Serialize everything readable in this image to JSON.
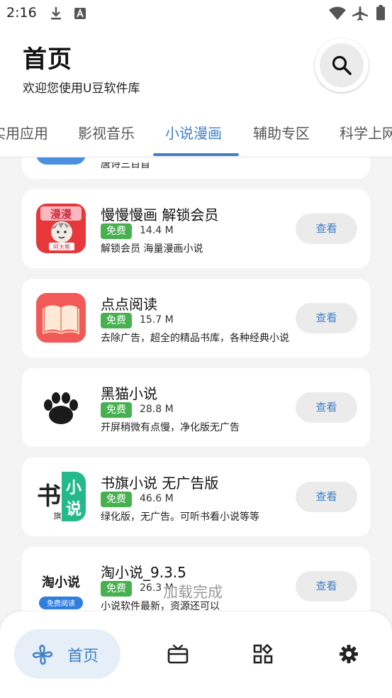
{
  "status_bar": {
    "time": "2:16"
  },
  "header": {
    "title": "首页",
    "subtitle": "欢迎您使用U豆软件库"
  },
  "tabs": [
    {
      "label": "实用应用"
    },
    {
      "label": "影视音乐"
    },
    {
      "label": "小说漫画"
    },
    {
      "label": "辅助专区"
    },
    {
      "label": "科学上网"
    }
  ],
  "active_tab": "小说漫画",
  "partial_item": {
    "desc": "唐诗三百首"
  },
  "apps": [
    {
      "name": "慢慢慢画 解锁会员",
      "badge": "免费",
      "size": "14.4 M",
      "desc": "解锁会员 海量漫画小说",
      "action": "查看"
    },
    {
      "name": "点点阅读",
      "badge": "免费",
      "size": "15.7 M",
      "desc": "去除广告，超全的精品书库，各种经典小说",
      "action": "查看"
    },
    {
      "name": "黑猫小说",
      "badge": "免费",
      "size": "28.8 M",
      "desc": "开屏稍微有点慢，净化版无广告",
      "action": "查看"
    },
    {
      "name": "书旗小说 无广告版",
      "badge": "免费",
      "size": "46.6 M",
      "desc": "绿化版，无广告。可听书看小说等等",
      "action": "查看"
    },
    {
      "name": "淘小说_9.3.5",
      "badge": "免费",
      "size": "26.3 M",
      "desc": "小说软件最新，资源还可以",
      "action": "查看"
    }
  ],
  "icon_text": {
    "manhua_top": "漫漫",
    "manhua_bottom": "阿大熊",
    "shuqi_left": "书",
    "shuqi_left_small": "旗",
    "shuqi_right": "小说",
    "tao_title": "淘小说",
    "tao_sub": "免费阅读"
  },
  "load_status": "加载完成",
  "bottom_nav": {
    "home_label": "首页"
  },
  "colors": {
    "accent": "#3f7fc4",
    "badge": "#47b04f",
    "button_bg": "#ebebeb"
  },
  "icons": [
    "download-icon",
    "a-letter-icon",
    "wifi-icon",
    "airplane-icon",
    "battery-icon",
    "search-icon",
    "pinwheel-icon",
    "tv-icon",
    "apps-grid-icon",
    "settings-gear-icon"
  ]
}
